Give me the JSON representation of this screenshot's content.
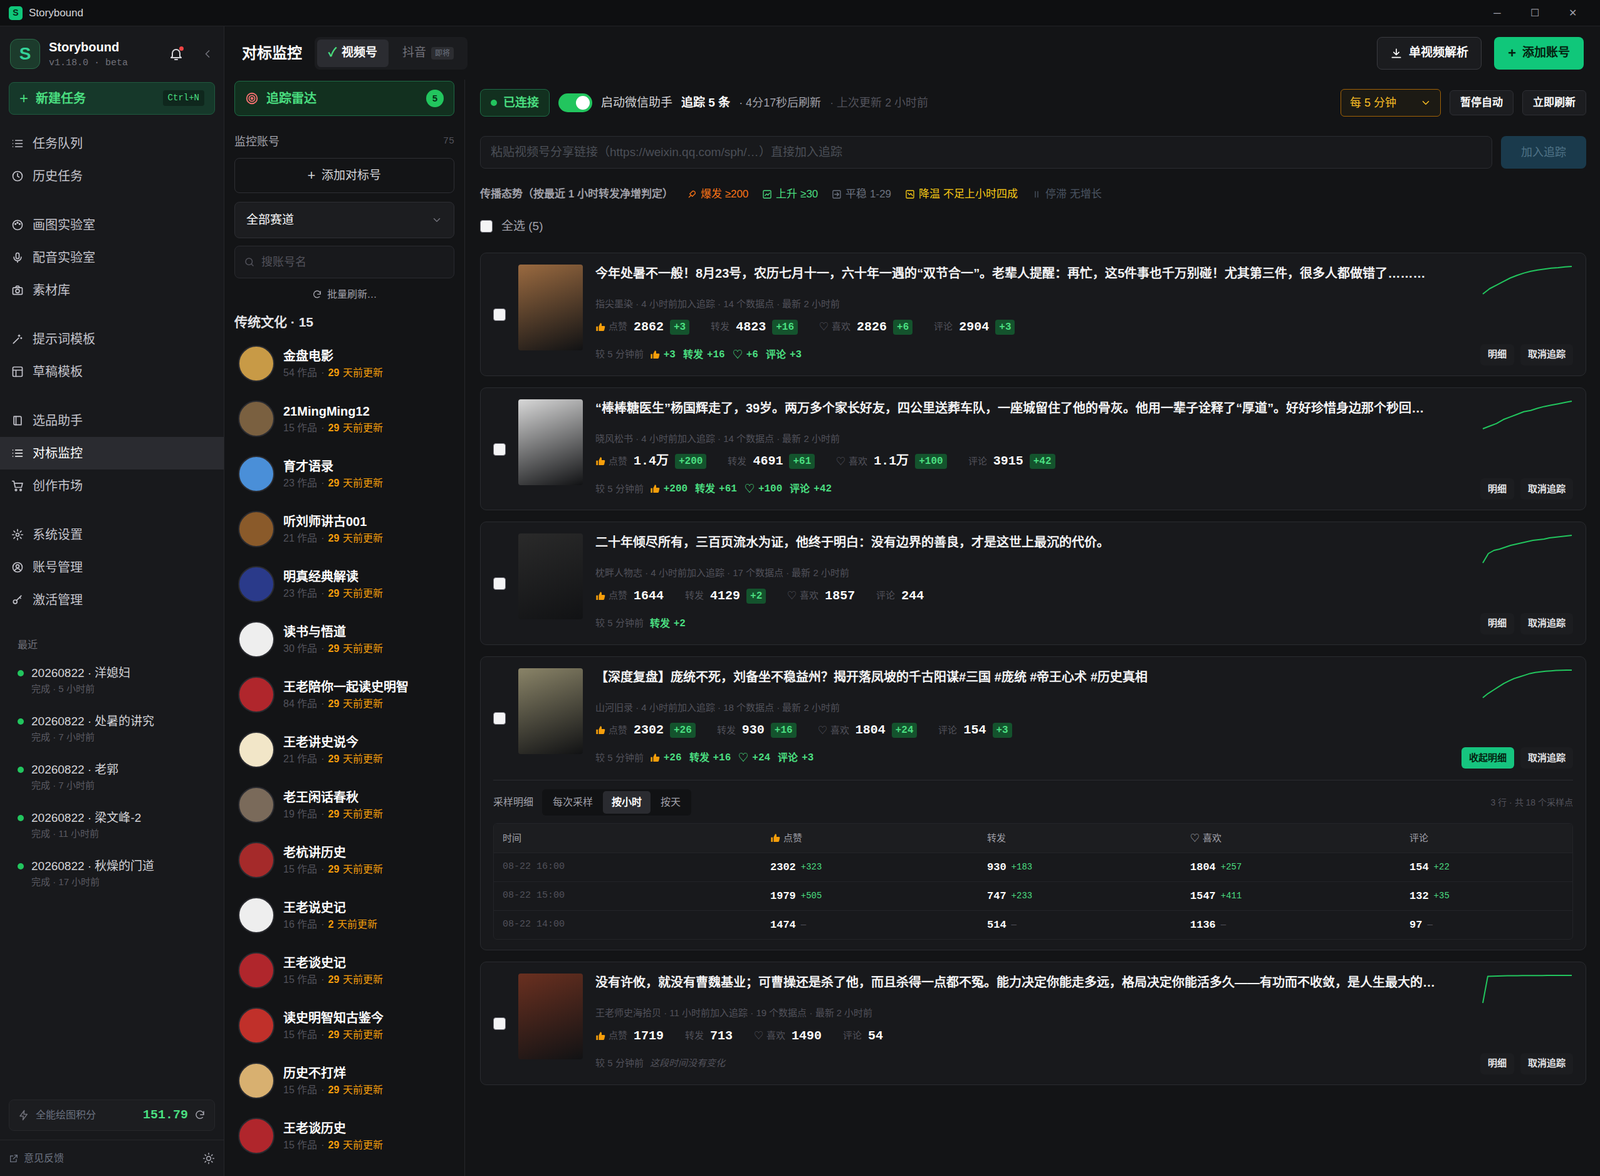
{
  "window": {
    "logo": "S",
    "title": "Storybound",
    "controls": [
      "─",
      "☐",
      "✕"
    ]
  },
  "sidebar": {
    "logo": "S",
    "app_name": "Storybound",
    "version": "v1.18.0 · beta",
    "unread": true,
    "new_task": {
      "icon": "+",
      "label": "新建任务",
      "shortcut": "Ctrl+N"
    },
    "nav": [
      [
        {
          "label": "任务队列",
          "selected": false
        },
        {
          "label": "历史任务",
          "selected": false
        }
      ],
      [
        {
          "label": "画图实验室",
          "selected": false
        },
        {
          "label": "配音实验室",
          "selected": false
        },
        {
          "label": "素材库",
          "selected": false
        }
      ],
      [
        {
          "label": "提示词模板",
          "selected": false
        },
        {
          "label": "草稿模板",
          "selected": false
        }
      ],
      [
        {
          "label": "选品助手",
          "selected": false
        },
        {
          "label": "对标监控",
          "selected": true
        },
        {
          "label": "创作市场",
          "selected": false
        }
      ],
      [
        {
          "label": "系统设置",
          "selected": false
        },
        {
          "label": "账号管理",
          "selected": false
        },
        {
          "label": "激活管理",
          "selected": false
        }
      ]
    ],
    "recent_title": "最近",
    "recent": [
      {
        "title": "20260822 · 洋媳妇",
        "sub": "完成 · 5 小时前",
        "color": "#22c55e"
      },
      {
        "title": "20260822 · 处暑的讲究",
        "sub": "完成 · 7 小时前",
        "color": "#22c55e"
      },
      {
        "title": "20260822 · 老郭",
        "sub": "完成 · 7 小时前",
        "color": "#22c55e"
      },
      {
        "title": "20260822 · 梁文峰-2",
        "sub": "完成 · 11 小时前",
        "color": "#22c55e"
      },
      {
        "title": "20260822 · 秋燥的门道",
        "sub": "完成 · 17 小时前",
        "color": "#22c55e"
      }
    ],
    "credits": {
      "label": "全能绘图积分",
      "value": "151.79"
    },
    "feedback": "意见反馈"
  },
  "header": {
    "title": "对标监控",
    "tabs": [
      {
        "check": "✓",
        "label": "视频号",
        "selected": true
      },
      {
        "label": "抖音",
        "badge": "即将",
        "selected": false
      }
    ],
    "buttons": [
      {
        "label": "单视频解析",
        "kind": "secondary"
      },
      {
        "icon": "+",
        "label": "添加账号",
        "kind": "primary"
      }
    ]
  },
  "accounts": {
    "radar": {
      "label": "追踪雷达",
      "count": "5",
      "selected": true
    },
    "monitor_label": "监控账号",
    "monitor_count": "75",
    "add": {
      "icon": "+",
      "label": "添加对标号"
    },
    "filter": "全部赛道",
    "search": {
      "placeholder": "搜账号名"
    },
    "refresh": "批量刷新…",
    "group": "传统文化 · 15",
    "sep": "·",
    "items": [
      {
        "name": "金盘电影",
        "works": "54 作品",
        "age": "29",
        "age_unit": "天前更新",
        "color": "#c89a46"
      },
      {
        "name": "21MingMing12",
        "works": "15 作品",
        "age": "29",
        "age_unit": "天前更新",
        "color": "#7a6040"
      },
      {
        "name": "育才语录",
        "works": "23 作品",
        "age": "29",
        "age_unit": "天前更新",
        "color": "#4a8fd8"
      },
      {
        "name": "听刘师讲古001",
        "works": "21 作品",
        "age": "29",
        "age_unit": "天前更新",
        "color": "#8a5a2a"
      },
      {
        "name": "明真经典解读",
        "works": "23 作品",
        "age": "29",
        "age_unit": "天前更新",
        "color": "#2a3a8a"
      },
      {
        "name": "读书与悟道",
        "works": "30 作品",
        "age": "29",
        "age_unit": "天前更新",
        "color": "#eeeeee"
      },
      {
        "name": "王老陪你一起读史明智",
        "works": "84 作品",
        "age": "29",
        "age_unit": "天前更新",
        "color": "#b0262c"
      },
      {
        "name": "王老讲史说今",
        "works": "21 作品",
        "age": "29",
        "age_unit": "天前更新",
        "color": "#f2e6c8"
      },
      {
        "name": "老王闲话春秋",
        "works": "19 作品",
        "age": "29",
        "age_unit": "天前更新",
        "color": "#7a6a5a"
      },
      {
        "name": "老杭讲历史",
        "works": "15 作品",
        "age": "29",
        "age_unit": "天前更新",
        "color": "#a52a2a"
      },
      {
        "name": "王老说史记",
        "works": "16 作品",
        "age": "2",
        "age_unit": "天前更新",
        "color": "#eeeeee"
      },
      {
        "name": "王老谈史记",
        "works": "15 作品",
        "age": "29",
        "age_unit": "天前更新",
        "color": "#b0262c"
      },
      {
        "name": "读史明智知古鉴今",
        "works": "15 作品",
        "age": "29",
        "age_unit": "天前更新",
        "color": "#c0302a"
      },
      {
        "name": "历史不打烊",
        "works": "15 作品",
        "age": "29",
        "age_unit": "天前更新",
        "color": "#d8b070"
      },
      {
        "name": "王老谈历史",
        "works": "15 作品",
        "age": "29",
        "age_unit": "天前更新",
        "color": "#b0262c"
      }
    ]
  },
  "monitor": {
    "status": {
      "connected": "已连接",
      "connected_on": true,
      "helper_on": true,
      "helper_label": "启动微信助手",
      "tracking": "追踪 5 条",
      "next": "· 4分17秒后刷新",
      "last": "· 上次更新 2 小时前"
    },
    "interval": "每 5 分钟",
    "pause": "暂停自动",
    "refresh_now": "立即刷新",
    "link_input": {
      "placeholder": "粘贴视频号分享链接（https://weixin.qq.com/sph/…）直接加入追踪",
      "button": "加入追踪",
      "disabled": true
    },
    "legend": {
      "title": "传播态势（按最近 1 小时转发净增判定）",
      "items": [
        {
          "label": "爆发 ≥200",
          "color": "#f97316"
        },
        {
          "label": "上升 ≥30",
          "color": "#4ade80"
        },
        {
          "label": "平稳 1-29",
          "color": "#6b7280"
        },
        {
          "label": "降温 不足上小时四成",
          "color": "#facc15"
        },
        {
          "label": "停滞 无增长",
          "color": "#4b5563"
        }
      ]
    },
    "select_all": {
      "label": "全选 (5)",
      "checked": false
    },
    "stat_defs": [
      {
        "label": "点赞",
        "kind": "thumb"
      },
      {
        "label": "转发",
        "kind": "plain"
      },
      {
        "label": "喜欢",
        "glyph": "♡",
        "kind": "heart"
      },
      {
        "label": "评论",
        "kind": "plain"
      }
    ],
    "delta_since": "较 5 分钟前",
    "no_change": "这段时间没有变化",
    "detail_btn": "明细",
    "collapse_btn": "收起明细",
    "untrack_btn": "取消追踪",
    "cards": [
      {
        "title": "今年处暑不一般！8月23号，农历七月十一，六十年一遇的“双节合一”。老辈人提醒：再忙，这5件事也千万别碰！尤其第三件，很多人都做错了………",
        "meta": "指尖墨染 · 4 小时前加入追踪 · 14 个数据点 · 最新 2 小时前",
        "selected": false,
        "expanded": false,
        "thumb_color": "#9a6a40",
        "stats": [
          {
            "value": "2862",
            "delta": "+3"
          },
          {
            "value": "4823",
            "delta": "+16"
          },
          {
            "value": "2826",
            "delta": "+6"
          },
          {
            "value": "2904",
            "delta": "+3"
          }
        ],
        "trend": [
          2800,
          2812,
          2820,
          2828,
          2836,
          2842,
          2847,
          2851,
          2854,
          2856,
          2858,
          2859,
          2861,
          2862
        ]
      },
      {
        "title": "“棒棒糖医生”杨国辉走了，39岁。两万多个家长好友，四公里送葬车队，一座城留住了他的骨灰。他用一辈子诠释了“厚道”。好好珍惜身边那个秒回…",
        "meta": "晓风松书 · 4 小时前加入追踪 · 14 个数据点 · 最新 2 小时前",
        "selected": false,
        "expanded": false,
        "thumb_color": "#d8d8d8",
        "stats": [
          {
            "value": "1.4万",
            "delta": "+200"
          },
          {
            "value": "4691",
            "delta": "+61"
          },
          {
            "value": "1.1万",
            "delta": "+100"
          },
          {
            "value": "3915",
            "delta": "+42"
          }
        ],
        "trend": [
          13000,
          13100,
          13200,
          13350,
          13450,
          13550,
          13650,
          13700,
          13780,
          13850,
          13900,
          13950,
          14000,
          14050
        ]
      },
      {
        "title": "二十年倾尽所有，三百页流水为证，他终于明白：没有边界的善良，才是这世上最沉的代价。",
        "meta": "枕畔人物志 · 4 小时前加入追踪 · 17 个数据点 · 最新 2 小时前",
        "selected": false,
        "expanded": false,
        "thumb_color": "#2a2a2a",
        "stats": [
          {
            "value": "1644",
            "delta": null
          },
          {
            "value": "4129",
            "delta": "+2"
          },
          {
            "value": "1857",
            "delta": null
          },
          {
            "value": "244",
            "delta": null
          }
        ],
        "trend": [
          1600,
          1615,
          1620,
          1622,
          1625,
          1628,
          1630,
          1632,
          1634,
          1636,
          1637,
          1638,
          1640,
          1641,
          1642,
          1643,
          1644
        ]
      },
      {
        "title": "【深度复盘】庞统不死，刘备坐不稳益州？揭开落凤坡的千古阳谋#三国 #庞统 #帝王心术 #历史真相",
        "meta": "山河旧录 · 4 小时前加入追踪 · 18 个数据点 · 最新 2 小时前",
        "selected": false,
        "expanded": true,
        "thumb_color": "#8a8468",
        "stats": [
          {
            "value": "2302",
            "delta": "+26"
          },
          {
            "value": "930",
            "delta": "+16"
          },
          {
            "value": "1804",
            "delta": "+24"
          },
          {
            "value": "154",
            "delta": "+3"
          }
        ],
        "trend": [
          1474,
          1600,
          1700,
          1800,
          1900,
          1979,
          2050,
          2100,
          2150,
          2200,
          2230,
          2250,
          2270,
          2280,
          2290,
          2296,
          2300,
          2302
        ],
        "detail": {
          "title": "采样明细",
          "modes": [
            {
              "label": "每次采样",
              "selected": false
            },
            {
              "label": "按小时",
              "selected": true
            },
            {
              "label": "按天",
              "selected": false
            }
          ],
          "summary": "3 行 · 共 18 个采样点",
          "time_label": "时间",
          "rows": [
            {
              "time": "08-22 16:00",
              "cells": [
                {
                  "value": "2302",
                  "delta": "+323"
                },
                {
                  "value": "930",
                  "delta": "+183"
                },
                {
                  "value": "1804",
                  "delta": "+257"
                },
                {
                  "value": "154",
                  "delta": "+22"
                }
              ]
            },
            {
              "time": "08-22 15:00",
              "cells": [
                {
                  "value": "1979",
                  "delta": "+505"
                },
                {
                  "value": "747",
                  "delta": "+233"
                },
                {
                  "value": "1547",
                  "delta": "+411"
                },
                {
                  "value": "132",
                  "delta": "+35"
                }
              ]
            },
            {
              "time": "08-22 14:00",
              "cells": [
                {
                  "value": "1474",
                  "delta": "—"
                },
                {
                  "value": "514",
                  "delta": "—"
                },
                {
                  "value": "1136",
                  "delta": "—"
                },
                {
                  "value": "97",
                  "delta": "—"
                }
              ]
            }
          ]
        }
      },
      {
        "title": "没有许攸，就没有曹魏基业；可曹操还是杀了他，而且杀得一点都不冤。能力决定你能走多远，格局决定你能活多久——有功而不收敛，是人生最大的…",
        "meta": "王老师史海拾贝 · 11 小时前加入追踪 · 19 个数据点 · 最新 2 小时前",
        "selected": false,
        "expanded": false,
        "thumb_color": "#6a3020",
        "stats": [
          {
            "value": "1719",
            "delta": null
          },
          {
            "value": "713",
            "delta": null
          },
          {
            "value": "1490",
            "delta": null
          },
          {
            "value": "54",
            "delta": null
          }
        ],
        "trend": [
          1200,
          1700,
          1705,
          1708,
          1710,
          1712,
          1713,
          1714,
          1715,
          1716,
          1716,
          1717,
          1717,
          1718,
          1718,
          1719,
          1719,
          1719,
          1719
        ]
      }
    ]
  }
}
